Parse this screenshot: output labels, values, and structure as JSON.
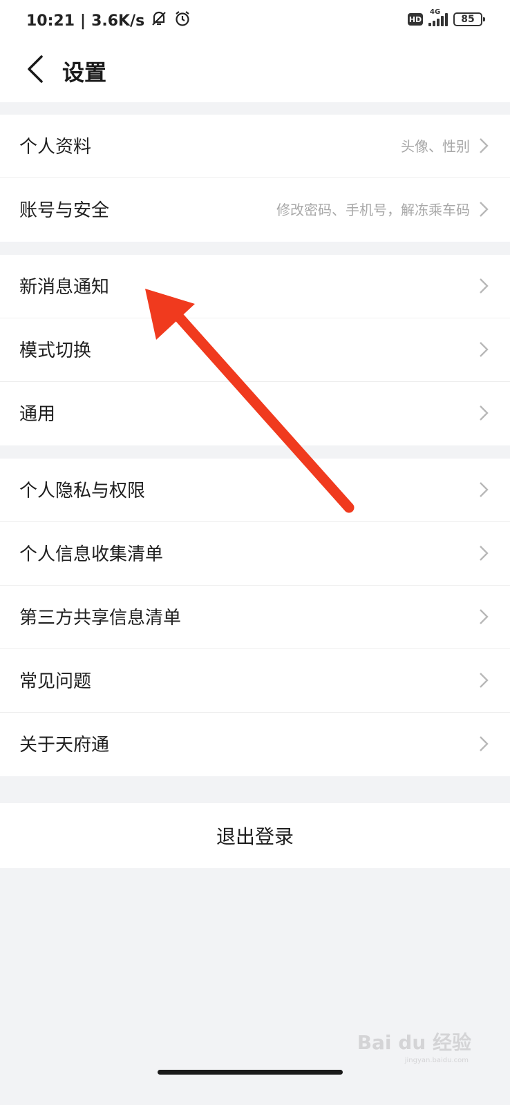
{
  "status_bar": {
    "time": "10:21",
    "net_speed": "3.6K/s",
    "mute_icon": "bell-off-icon",
    "alarm_icon": "alarm-clock-icon",
    "hd_badge": "HD",
    "network_type": "4G",
    "battery": "85"
  },
  "header": {
    "back_icon": "chevron-left-icon",
    "title": "设置"
  },
  "groups": [
    {
      "items": [
        {
          "label": "个人资料",
          "sub": "头像、性别"
        },
        {
          "label": "账号与安全",
          "sub": "修改密码、手机号，解冻乘车码"
        }
      ]
    },
    {
      "items": [
        {
          "label": "新消息通知"
        },
        {
          "label": "模式切换"
        },
        {
          "label": "通用"
        }
      ]
    },
    {
      "items": [
        {
          "label": "个人隐私与权限"
        },
        {
          "label": "个人信息收集清单"
        },
        {
          "label": "第三方共享信息清单"
        },
        {
          "label": "常见问题"
        },
        {
          "label": "关于天府通"
        }
      ]
    }
  ],
  "logout_label": "退出登录",
  "annotation_color": "#f03a1e",
  "watermark": {
    "text": "Bai du 经验",
    "sub": "jingyan.baidu.com"
  }
}
